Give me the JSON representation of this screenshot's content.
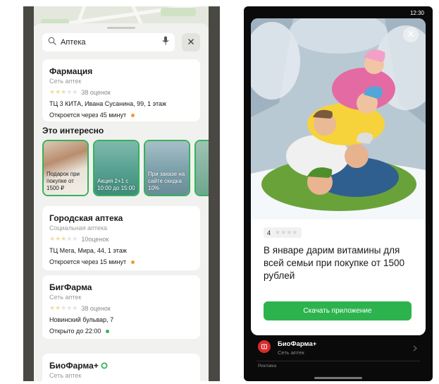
{
  "left": {
    "search": {
      "value": "Аптека",
      "icons": [
        "search-icon",
        "microphone-icon",
        "close-icon"
      ]
    },
    "cards_top": [
      {
        "title": "Фармация",
        "subtitle": "Сеть аптек",
        "rating_stars": 3,
        "reviews": "38 оценок",
        "address": "ТЦ 3 КИТА, Ивана Сусанина, 99, 1 этаж",
        "hours": "Откроется через 45 минут",
        "status_color": "#f39a2b"
      }
    ],
    "section_title": "Это интересно",
    "promos": [
      {
        "text": "Подарок при покупке от 1500 ₽"
      },
      {
        "text": "Акция 2+1 с 10:00 до 15:00"
      },
      {
        "text": "При заказе на сайте скидка 10%"
      },
      {
        "text": ""
      }
    ],
    "cards_bottom": [
      {
        "title": "Городская аптека",
        "subtitle": "Социальная аптека",
        "rating_stars": 3,
        "reviews": "10оценок",
        "address": "ТЦ Мега, Мира, 44, 1 этаж",
        "hours": "Откроется через 15 минут",
        "status_color": "#f39a2b"
      },
      {
        "title": "БигФарма",
        "subtitle": "Сеть аптек",
        "rating_stars": 2,
        "reviews": "38 оценок",
        "address": "Новинский бульвар, 7",
        "hours": "Открыто до 22:00",
        "status_color": "#35b25a"
      },
      {
        "title": "БиоФарма+",
        "subtitle": "Сеть аптек"
      }
    ]
  },
  "right": {
    "status_time": "12:30",
    "rating_value": "4",
    "headline": "В январе дарим витамины для всей семьи при покупке от 1500 рублей",
    "cta_label": "Скачать приложение",
    "brand": {
      "name": "БиоФарма+",
      "subtitle": "Сеть аптек"
    },
    "ad_label": "Реклама"
  },
  "colors": {
    "accent_green": "#2db34e",
    "closed_orange": "#f39a2b",
    "open_green": "#35b25a",
    "brand_red": "#d92a2a"
  }
}
